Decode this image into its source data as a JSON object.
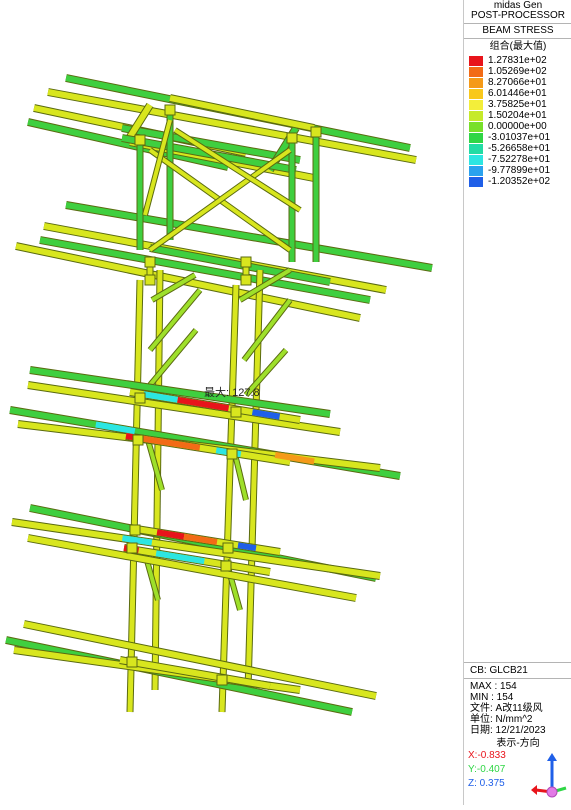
{
  "panel": {
    "app_name": "midas Gen",
    "module": "POST-PROCESSOR",
    "result_type": "BEAM STRESS",
    "component": "组合(最大值)",
    "legend": [
      {
        "value": "1.27831e+02",
        "color": "#e8141b"
      },
      {
        "value": "1.05269e+02",
        "color": "#f26b16"
      },
      {
        "value": "8.27066e+01",
        "color": "#f59a18"
      },
      {
        "value": "6.01446e+01",
        "color": "#f9c81b"
      },
      {
        "value": "3.75825e+01",
        "color": "#f3ee3a"
      },
      {
        "value": "1.50204e+01",
        "color": "#c6ea2a"
      },
      {
        "value": "0.00000e+00",
        "color": "#78e02a"
      },
      {
        "value": "-3.01037e+01",
        "color": "#2fd645"
      },
      {
        "value": "-5.26658e+01",
        "color": "#22dca4"
      },
      {
        "value": "-7.52278e+01",
        "color": "#2ce6e2"
      },
      {
        "value": "-9.77899e+01",
        "color": "#2aa2ee"
      },
      {
        "value": "-1.20352e+02",
        "color": "#1f5fe8"
      }
    ],
    "cb": "CB: GLCB21",
    "max": "MAX : 154",
    "min": "MIN : 154",
    "file": "文件: A改11级风",
    "unit": "单位: N/mm^2",
    "date": "日期: 12/21/2023",
    "view_dir_label": "表示-方向",
    "axis_x": "X:-0.833",
    "axis_y": "Y:-0.407",
    "axis_z": "Z: 0.375",
    "axis_colors": {
      "x": "#e8141b",
      "y": "#2fd645",
      "z": "#1f5fe8"
    }
  },
  "model": {
    "max_label": "最大: 127.8",
    "colors": {
      "beam_yellow": "#d8e61e",
      "beam_green": "#3fcf3f",
      "beam_lime": "#9ee02a",
      "outline": "#5a6a10"
    }
  }
}
